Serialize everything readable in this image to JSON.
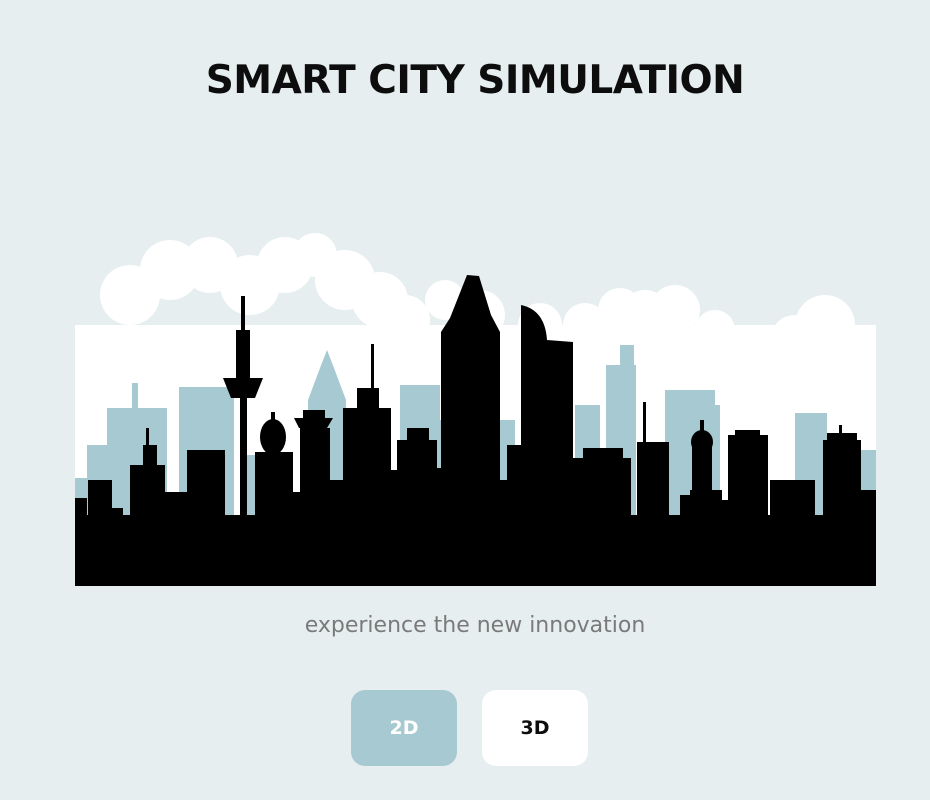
{
  "header": {
    "title": "SMART CITY SIMULATION"
  },
  "hero": {
    "image_name": "city-skyline-illustration",
    "tagline": "experience the new innovation"
  },
  "mode_toggle": {
    "selected": "2D",
    "options": [
      {
        "label": "2D",
        "active": true
      },
      {
        "label": "3D",
        "active": false
      }
    ]
  },
  "colors": {
    "background": "#e6eef0",
    "accent": "#a7c9d1",
    "skyline_foreground": "#000000",
    "skyline_background_buildings": "#a7c9d1",
    "clouds": "#ffffff",
    "tagline": "#7a7a7a"
  }
}
